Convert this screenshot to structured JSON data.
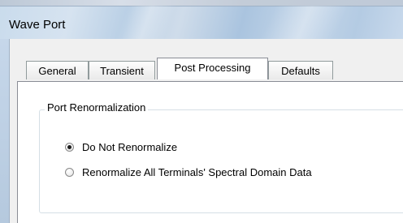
{
  "window": {
    "title": "Wave Port"
  },
  "tabs": [
    {
      "label": "General",
      "active": false
    },
    {
      "label": "Transient",
      "active": false
    },
    {
      "label": "Post Processing",
      "active": true
    },
    {
      "label": "Defaults",
      "active": false
    }
  ],
  "port_renormalization": {
    "group_label": "Port Renormalization",
    "options": [
      {
        "label": "Do Not Renormalize",
        "selected": true
      },
      {
        "label": "Renormalize All Terminals' Spectral Domain Data",
        "selected": false
      }
    ]
  }
}
